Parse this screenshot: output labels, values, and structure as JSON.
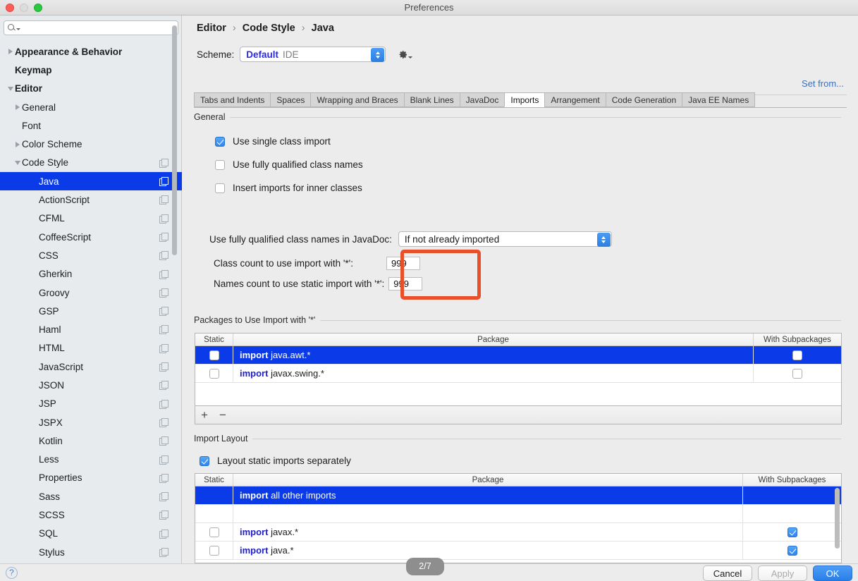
{
  "window": {
    "title": "Preferences"
  },
  "search": {
    "placeholder": "",
    "value": "",
    "icon": "search-icon"
  },
  "sidebar": {
    "items": [
      {
        "label": "Appearance & Behavior",
        "level": 0,
        "arrow": "collapsed",
        "copy": false,
        "selected": false
      },
      {
        "label": "Keymap",
        "level": 0,
        "arrow": "none",
        "copy": false,
        "selected": false
      },
      {
        "label": "Editor",
        "level": 0,
        "arrow": "expanded",
        "copy": false,
        "selected": false
      },
      {
        "label": "General",
        "level": 1,
        "arrow": "collapsed",
        "copy": false,
        "selected": false
      },
      {
        "label": "Font",
        "level": 1,
        "arrow": "none",
        "copy": false,
        "selected": false
      },
      {
        "label": "Color Scheme",
        "level": 1,
        "arrow": "collapsed",
        "copy": false,
        "selected": false
      },
      {
        "label": "Code Style",
        "level": 1,
        "arrow": "expanded",
        "copy": true,
        "selected": false
      },
      {
        "label": "Java",
        "level": 2,
        "arrow": "none",
        "copy": true,
        "selected": true
      },
      {
        "label": "ActionScript",
        "level": 2,
        "arrow": "none",
        "copy": true,
        "selected": false
      },
      {
        "label": "CFML",
        "level": 2,
        "arrow": "none",
        "copy": true,
        "selected": false
      },
      {
        "label": "CoffeeScript",
        "level": 2,
        "arrow": "none",
        "copy": true,
        "selected": false
      },
      {
        "label": "CSS",
        "level": 2,
        "arrow": "none",
        "copy": true,
        "selected": false
      },
      {
        "label": "Gherkin",
        "level": 2,
        "arrow": "none",
        "copy": true,
        "selected": false
      },
      {
        "label": "Groovy",
        "level": 2,
        "arrow": "none",
        "copy": true,
        "selected": false
      },
      {
        "label": "GSP",
        "level": 2,
        "arrow": "none",
        "copy": true,
        "selected": false
      },
      {
        "label": "Haml",
        "level": 2,
        "arrow": "none",
        "copy": true,
        "selected": false
      },
      {
        "label": "HTML",
        "level": 2,
        "arrow": "none",
        "copy": true,
        "selected": false
      },
      {
        "label": "JavaScript",
        "level": 2,
        "arrow": "none",
        "copy": true,
        "selected": false
      },
      {
        "label": "JSON",
        "level": 2,
        "arrow": "none",
        "copy": true,
        "selected": false
      },
      {
        "label": "JSP",
        "level": 2,
        "arrow": "none",
        "copy": true,
        "selected": false
      },
      {
        "label": "JSPX",
        "level": 2,
        "arrow": "none",
        "copy": true,
        "selected": false
      },
      {
        "label": "Kotlin",
        "level": 2,
        "arrow": "none",
        "copy": true,
        "selected": false
      },
      {
        "label": "Less",
        "level": 2,
        "arrow": "none",
        "copy": true,
        "selected": false
      },
      {
        "label": "Properties",
        "level": 2,
        "arrow": "none",
        "copy": true,
        "selected": false
      },
      {
        "label": "Sass",
        "level": 2,
        "arrow": "none",
        "copy": true,
        "selected": false
      },
      {
        "label": "SCSS",
        "level": 2,
        "arrow": "none",
        "copy": true,
        "selected": false
      },
      {
        "label": "SQL",
        "level": 2,
        "arrow": "none",
        "copy": true,
        "selected": false
      },
      {
        "label": "Stylus",
        "level": 2,
        "arrow": "none",
        "copy": true,
        "selected": false
      }
    ]
  },
  "breadcrumb": {
    "p1": "Editor",
    "sep": "›",
    "p2": "Code Style",
    "p3": "Java"
  },
  "scheme": {
    "label": "Scheme:",
    "selected": "Default",
    "scope": "IDE",
    "gear_icon": "gear-icon",
    "set_from_link": "Set from..."
  },
  "tabs": [
    {
      "label": "Tabs and Indents",
      "active": false
    },
    {
      "label": "Spaces",
      "active": false
    },
    {
      "label": "Wrapping and Braces",
      "active": false
    },
    {
      "label": "Blank Lines",
      "active": false
    },
    {
      "label": "JavaDoc",
      "active": false
    },
    {
      "label": "Imports",
      "active": true
    },
    {
      "label": "Arrangement",
      "active": false
    },
    {
      "label": "Code Generation",
      "active": false
    },
    {
      "label": "Java EE Names",
      "active": false
    }
  ],
  "general": {
    "title": "General",
    "checkboxes": [
      {
        "label": "Use single class import",
        "checked": true
      },
      {
        "label": "Use fully qualified class names",
        "checked": false
      },
      {
        "label": "Insert imports for inner classes",
        "checked": false
      }
    ],
    "javadoc_label": "Use fully qualified class names in JavaDoc:",
    "javadoc_value": "If not already imported",
    "class_count_label": "Class count to use import with '*':",
    "class_count_value": "999",
    "names_count_label": "Names count to use static import with '*':",
    "names_count_value": "999",
    "highlight_color": "#e8502a"
  },
  "packages_section": {
    "title": "Packages to Use Import with '*'",
    "columns": [
      "Static",
      "Package",
      "With Subpackages"
    ],
    "rows": [
      {
        "static_checked": false,
        "prefix": "import",
        "package": "java.awt.*",
        "sub_visible": true,
        "sub_checked": false,
        "selected": true
      },
      {
        "static_checked": false,
        "prefix": "import",
        "package": "javax.swing.*",
        "sub_visible": true,
        "sub_checked": false,
        "selected": false
      }
    ],
    "add_label": "+",
    "remove_label": "−"
  },
  "import_layout_section": {
    "title": "Import Layout",
    "checkbox_label": "Layout static imports separately",
    "checkbox_checked": true,
    "columns": [
      "Static",
      "Package",
      "With Subpackages"
    ],
    "rows": [
      {
        "static_visible": false,
        "prefix": "import",
        "package": "all other imports",
        "sub_visible": false,
        "sub_checked": false,
        "selected": true,
        "blank": false
      },
      {
        "static_visible": false,
        "prefix": "",
        "package": "<blank line>",
        "sub_visible": false,
        "sub_checked": false,
        "selected": false,
        "blank": true
      },
      {
        "static_visible": true,
        "prefix": "import",
        "package": "javax.*",
        "sub_visible": true,
        "sub_checked": true,
        "selected": false,
        "blank": false
      },
      {
        "static_visible": true,
        "prefix": "import",
        "package": "java.*",
        "sub_visible": true,
        "sub_checked": true,
        "selected": false,
        "blank": false
      }
    ]
  },
  "footer": {
    "help_label": "?",
    "page_indicator": "2/7",
    "cancel_label": "Cancel",
    "apply_label": "Apply",
    "ok_label": "OK",
    "ok_color": "#2a7fe8"
  }
}
